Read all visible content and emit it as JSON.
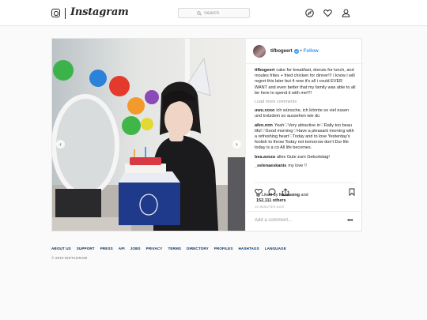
{
  "header": {
    "wordmark": "Instagram",
    "search_placeholder": "Search",
    "icons": [
      "instagram-camera-icon",
      "search-icon",
      "compass-icon",
      "heart-icon",
      "profile-icon"
    ]
  },
  "post": {
    "username": "tifbogeert",
    "follow_label": "Follow",
    "separator": "•",
    "caption_user": "tifbogeert",
    "caption": "cake for breakfast, donuts for lunch, and moules frites + fried chicken for dinner!!! i know i will regret this later but 4 now it's all i could EVER WANT and even better that my family was able to all be here to spend it with me!!!!",
    "load_more": "Load more comments",
    "comments": [
      {
        "user": "uwu.xoxo",
        "text": "ich wünsche, ich könnte so viel essen und trotzdem so aussehen wie du"
      },
      {
        "user": "afen.nnn",
        "text": "Yeah♡Very attractive in♡Rally too beau tiful♡Good morning♡Have a pleasant morning with a refreshing heart♡Today and to love Yesterday's foolish to throw Today not tomorrow don't Dur life today is a co All life becomes."
      },
      {
        "user": "bea.aveza",
        "text": "alles Gute zum Geburtstag!"
      },
      {
        "user": "_selenaeskanis",
        "text": "my love !!"
      }
    ],
    "likes_prefix": "Liked by",
    "liked_by_user": "hanasong",
    "likes_and": "and",
    "likes_others": "152,111 others",
    "timestamp": "15 MINUTES AGO",
    "add_comment_placeholder": "Add a comment...",
    "more_options": "•••",
    "photo_arrows": {
      "prev": "‹",
      "next": "›"
    }
  },
  "footer": {
    "links": [
      "ABOUT US",
      "SUPPORT",
      "PRESS",
      "API",
      "JOBS",
      "PRIVACY",
      "TERMS",
      "DIRECTORY",
      "PROFILES",
      "HASHTAGS",
      "LANGUAGE"
    ],
    "copyright": "© 2019 INSTAGRAM"
  },
  "colors": {
    "link_blue": "#3897f0",
    "footer_link": "#003569",
    "border": "#e6e6e6",
    "background": "#fafafa"
  }
}
